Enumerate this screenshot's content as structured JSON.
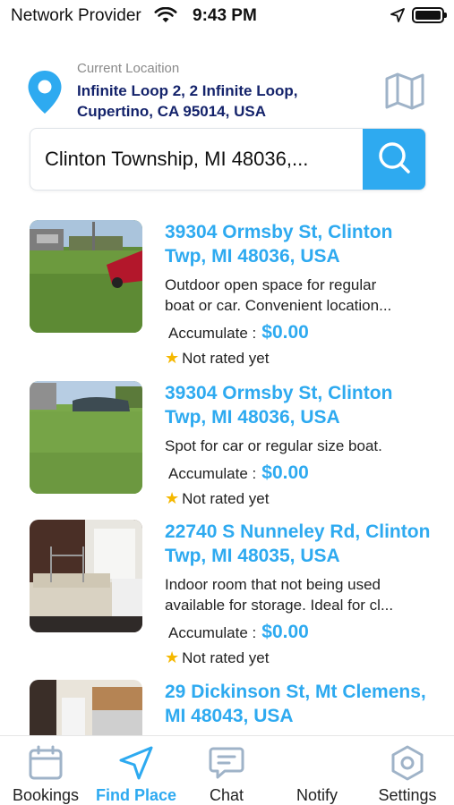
{
  "status_bar": {
    "carrier": "Network Provider",
    "time": "9:43 PM",
    "icons": [
      "wifi-icon",
      "location-arrow-icon",
      "battery-icon"
    ]
  },
  "location": {
    "label": "Current Locaition",
    "address": "Infinite Loop 2, 2 Infinite Loop, Cupertino, CA 95014, USA",
    "pin_icon": "map-pin-icon",
    "map_icon": "map-icon"
  },
  "search": {
    "value": "Clinton Township, MI 48036,...",
    "button_icon": "search-icon"
  },
  "listings": [
    {
      "title": "39304 Ormsby St, Clinton Twp, MI 48036, USA",
      "description": "Outdoor open space for regular boat or car. Convenient location...",
      "desc_line1": "Outdoor open space for regular",
      "desc_line2": "boat or car. Convenient location...",
      "accumulate_label": "Accumulate :",
      "price": "$0.00",
      "rating": "Not rated yet"
    },
    {
      "title": "39304 Ormsby St, Clinton Twp, MI 48036, USA",
      "description": "Spot for car or regular size boat.",
      "accumulate_label": "Accumulate :",
      "price": "$0.00",
      "rating": "Not rated yet"
    },
    {
      "title": "22740 S Nunneley Rd, Clinton Twp, MI 48035, USA",
      "description": "Indoor room that not being used available for storage. Ideal for cl...",
      "desc_line1": "Indoor room that not being used",
      "desc_line2": "available for storage. Ideal for cl...",
      "accumulate_label": "Accumulate :",
      "price": "$0.00",
      "rating": "Not rated yet"
    },
    {
      "title": "29 Dickinson St, Mt Clemens, MI 48043, USA"
    }
  ],
  "tabs": [
    {
      "label": "Bookings",
      "icon": "calendar-icon",
      "active": false
    },
    {
      "label": "Find Place",
      "icon": "navigation-icon",
      "active": true
    },
    {
      "label": "Chat",
      "icon": "chat-icon",
      "active": false
    },
    {
      "label": "Notify",
      "icon": "bell-icon",
      "active": false
    },
    {
      "label": "Settings",
      "icon": "settings-icon",
      "active": false
    }
  ],
  "colors": {
    "accent": "#2eaaf0",
    "address_text": "#14236b",
    "muted": "#8a8a8a",
    "star": "#f5b800"
  }
}
